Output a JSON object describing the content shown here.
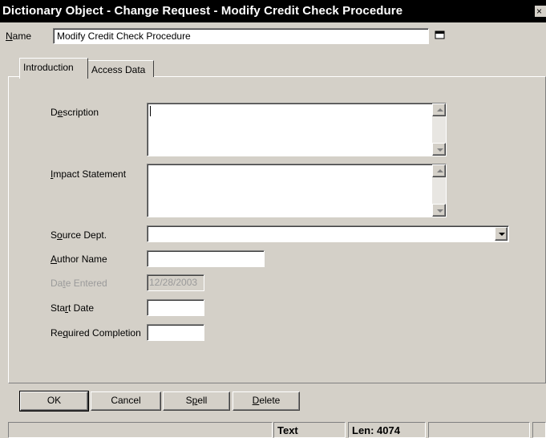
{
  "window": {
    "title": "Dictionary Object - Change Request - Modify Credit Check Procedure",
    "close_glyph": "×"
  },
  "name_row": {
    "label": "Name",
    "accesskey": "N",
    "label_rest": "ame",
    "value": "Modify Credit Check Procedure",
    "button_icon": "maximize-icon"
  },
  "tabs": [
    {
      "label": "Introduction",
      "active": true
    },
    {
      "label": "Access Data",
      "active": false
    }
  ],
  "fields": {
    "description": {
      "pre": "D",
      "key": "e",
      "post": "scription",
      "value": ""
    },
    "impact": {
      "pre": "",
      "key": "I",
      "post": "mpact Statement",
      "value": ""
    },
    "source_dept": {
      "pre": "S",
      "key": "o",
      "post": "urce Dept.",
      "value": ""
    },
    "author_name": {
      "pre": "",
      "key": "A",
      "post": "uthor Name",
      "value": ""
    },
    "date_entered": {
      "pre": "Da",
      "key": "t",
      "post": "e Entered",
      "value": "12/28/2003"
    },
    "start_date": {
      "pre": "Sta",
      "key": "r",
      "post": "t Date",
      "value": ""
    },
    "required_completion": {
      "pre": "Re",
      "key": "q",
      "post": "uired Completion",
      "value": ""
    }
  },
  "buttons": {
    "ok": "OK",
    "cancel": "Cancel",
    "spell": {
      "pre": "S",
      "key": "p",
      "post": "ell"
    },
    "delete": {
      "pre": "",
      "key": "D",
      "post": "elete"
    }
  },
  "status_bar": {
    "mode": "Text",
    "length": "Len: 4074"
  }
}
